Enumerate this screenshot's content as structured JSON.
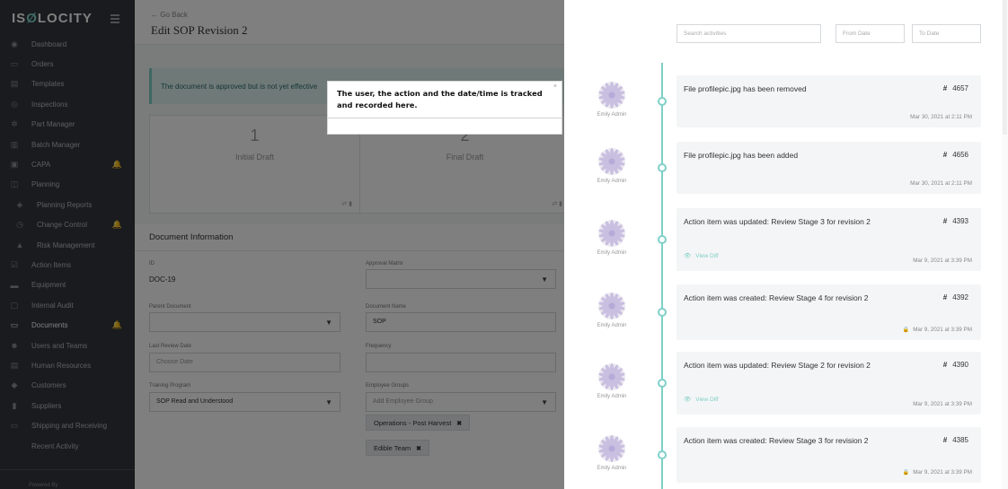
{
  "sidebar": {
    "logo": "ISOLOCITY",
    "items": [
      {
        "label": "Dashboard",
        "icon": "dashboard-icon",
        "glyph": "◉"
      },
      {
        "label": "Orders",
        "icon": "orders-icon",
        "glyph": "▭"
      },
      {
        "label": "Templates",
        "icon": "templates-icon",
        "glyph": "▤"
      },
      {
        "label": "Inspections",
        "icon": "inspections-icon",
        "glyph": "◎"
      },
      {
        "label": "Part Manager",
        "icon": "part-manager-icon",
        "glyph": "✲"
      },
      {
        "label": "Batch Manager",
        "icon": "batch-manager-icon",
        "glyph": "▥"
      },
      {
        "label": "CAPA",
        "icon": "capa-icon",
        "glyph": "▣",
        "alert": true
      },
      {
        "label": "Planning",
        "icon": "planning-icon",
        "glyph": "◫"
      },
      {
        "label": "Planning Reports",
        "icon": "planning-reports-icon",
        "glyph": "◈",
        "sub": true
      },
      {
        "label": "Change Control",
        "icon": "change-control-icon",
        "glyph": "◷",
        "sub": true,
        "alert": true
      },
      {
        "label": "Risk Management",
        "icon": "risk-management-icon",
        "glyph": "▲",
        "sub": true
      },
      {
        "label": "Action Items",
        "icon": "action-items-icon",
        "glyph": "☑"
      },
      {
        "label": "Equipment",
        "icon": "equipment-icon",
        "glyph": "▬"
      },
      {
        "label": "Internal Audit",
        "icon": "internal-audit-icon",
        "glyph": "▢"
      },
      {
        "label": "Documents",
        "icon": "documents-icon",
        "glyph": "▭",
        "active": true,
        "alert": true
      },
      {
        "label": "Users and Teams",
        "icon": "users-icon",
        "glyph": "☻"
      },
      {
        "label": "Human Resources",
        "icon": "human-resources-icon",
        "glyph": "▤"
      },
      {
        "label": "Customers",
        "icon": "customers-icon",
        "glyph": "◆"
      },
      {
        "label": "Suppliers",
        "icon": "suppliers-icon",
        "glyph": "▮"
      },
      {
        "label": "Shipping and Receiving",
        "icon": "shipping-icon",
        "glyph": "▭"
      },
      {
        "label": "Recent Activity",
        "icon": "",
        "glyph": ""
      }
    ],
    "powered_by": "Powered By"
  },
  "main": {
    "go_back": "←  Go Back",
    "title": "Edit SOP Revision 2",
    "notice": "The document is approved but is not yet effective",
    "steps": [
      {
        "number": "1",
        "name": "Initial Draft"
      },
      {
        "number": "2",
        "name": "Final Draft"
      }
    ],
    "doc_info_title": "Document Information",
    "fields": {
      "id_label": "ID",
      "id_value": "DOC-19",
      "approval_matrix_label": "Approval Matrix",
      "parent_document_label": "Parent Document",
      "document_name_label": "Document Name",
      "document_name_value": "SOP",
      "last_review_label": "Last Review Date",
      "last_review_placeholder": "Choose Date",
      "frequency_label": "Frequency",
      "training_program_label": "Training Program",
      "training_program_value": "SOP Read and Understood",
      "employee_groups_label": "Employee Groups",
      "employee_groups_placeholder": "Add Employee Group",
      "chips": [
        "Operations - Post Harvest",
        "Edible Team"
      ]
    }
  },
  "tooltip": {
    "text": "The user, the action and the date/time is tracked and recorded here.",
    "close": "×"
  },
  "activity": {
    "search_placeholder": "Search activities",
    "from_placeholder": "From Date",
    "to_placeholder": "To Date",
    "view_diff_label": "View Diff",
    "entries": [
      {
        "user": "Emily Admin",
        "message": "File profilepic.jpg has been removed",
        "id": "4657",
        "date": "Mar 30, 2021 at 2:11 PM",
        "view_diff": false,
        "locked": false
      },
      {
        "user": "Emily Admin",
        "message": "File profilepic.jpg has been added",
        "id": "4656",
        "date": "Mar 30, 2021 at 2:11 PM",
        "view_diff": false,
        "locked": false
      },
      {
        "user": "Emily Admin",
        "message": "Action item was updated: Review Stage 3 for revision 2",
        "id": "4393",
        "date": "Mar 9, 2021 at 3:39 PM",
        "view_diff": true,
        "locked": false
      },
      {
        "user": "Emily Admin",
        "message": "Action item was created: Review Stage 4 for revision 2",
        "id": "4392",
        "date": "Mar 9, 2021 at 3:39 PM",
        "view_diff": false,
        "locked": true
      },
      {
        "user": "Emily Admin",
        "message": "Action item was updated: Review Stage 2 for revision 2",
        "id": "4390",
        "date": "Mar 9, 2021 at 3:39 PM",
        "view_diff": true,
        "locked": false
      },
      {
        "user": "Emily Admin",
        "message": "Action item was created: Review Stage 3 for revision 2",
        "id": "4385",
        "date": "Mar 9, 2021 at 3:39 PM",
        "view_diff": false,
        "locked": true
      }
    ]
  },
  "colors": {
    "sidebar_bg": "#33373d",
    "accent": "#7fd0c7",
    "alert": "#e25b5b"
  }
}
